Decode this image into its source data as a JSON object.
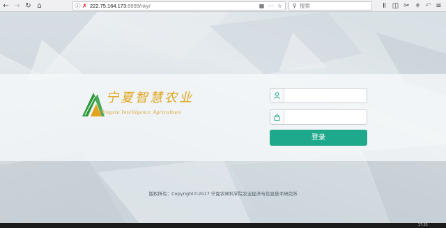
{
  "browser": {
    "url_host": "222.75.164.173",
    "url_rest": ":9999/nky/",
    "search_placeholder": "搜索",
    "icons": {
      "back": "back-arrow-icon",
      "forward": "forward-arrow-icon",
      "reload": "reload-icon",
      "home": "home-icon",
      "info": "info-icon",
      "insecure": "insecure-lock-icon",
      "qr": "qr-code-icon",
      "more": "more-dots-icon",
      "bookmark": "bookmark-star-icon",
      "search": "search-icon",
      "library": "library-icon",
      "sidebar": "sidebar-icon",
      "screenshot": "screenshot-icon",
      "addon": "addon-icon",
      "undo": "undo-icon",
      "menu": "menu-icon"
    }
  },
  "logo": {
    "title_cn": "宁夏智慧农业",
    "subtitle_en": "Ningxia Intelligence Agriculture",
    "colors": {
      "gold": "#e2a41d",
      "green": "#2e9a3b"
    }
  },
  "login": {
    "username_value": "",
    "password_value": "",
    "button_label": "登录",
    "button_color": "#1fa98c",
    "icons": {
      "username": "user-icon",
      "password": "lock-icon"
    }
  },
  "footer": {
    "text": "版权所有：Copyright©2017 宁夏农林科学院农业经济与信息技术研究所"
  },
  "taskbar": {
    "clock": "17:35"
  }
}
